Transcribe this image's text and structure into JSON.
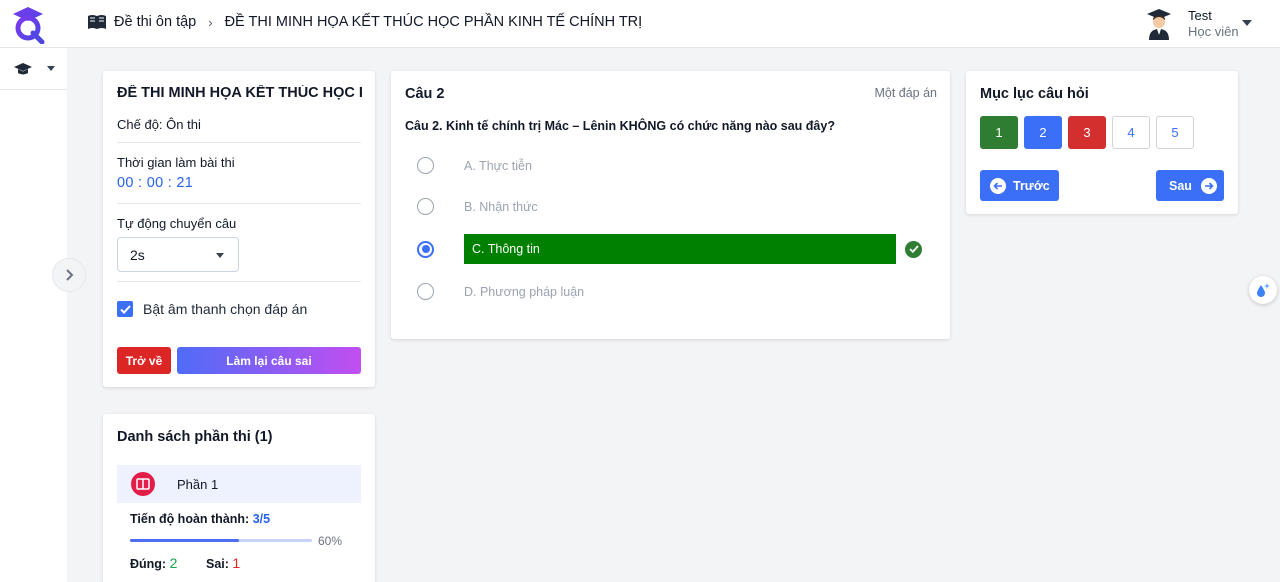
{
  "header": {
    "breadcrumb_root": "Đề thi ôn tập",
    "breadcrumb_current": "ĐỀ THI MINH HỌA KẾT THÚC HỌC PHẦN KINH TẾ CHÍNH TRỊ",
    "user_name": "Test",
    "user_role": "Học viên"
  },
  "info": {
    "title": "ĐỀ THI MINH HỌA KẾT THÚC HỌC PHẦN KINH TẾ CHÍNH TRỊ",
    "mode": "Chế độ: Ôn thi",
    "time_label": "Thời gian làm bài thi",
    "timer": "00 : 00 : 21",
    "auto_label": "Tự động chuyển câu",
    "auto_value": "2s",
    "sound_label": "Bật âm thanh chọn đáp án",
    "sound_checked": true,
    "back_label": "Trở về",
    "redo_label": "Làm lại câu sai"
  },
  "parts": {
    "title": "Danh sách phần thi (1)",
    "items": [
      {
        "name": "Phần 1",
        "progress_label": "Tiến độ hoàn thành:",
        "progress_value": "3/5",
        "progress_percent": 60,
        "percent_label": "60%",
        "correct_label": "Đúng:",
        "correct_value": "2",
        "wrong_label": "Sai:",
        "wrong_value": "1"
      }
    ]
  },
  "question": {
    "number_label": "Câu 2",
    "type_label": "Một đáp án",
    "text": "Câu 2. Kinh tế chính trị Mác – Lênin KHÔNG có chức năng nào sau đây?",
    "options": [
      {
        "label": "A. Thực tiễn",
        "selected": false
      },
      {
        "label": "B. Nhận thức",
        "selected": false
      },
      {
        "label": "C. Thông tin",
        "selected": true,
        "correct": true
      },
      {
        "label": "D. Phương pháp luận",
        "selected": false
      }
    ]
  },
  "index": {
    "title": "Mục lục câu hỏi",
    "items": [
      {
        "label": "1",
        "status": "correct"
      },
      {
        "label": "2",
        "status": "current"
      },
      {
        "label": "3",
        "status": "wrong"
      },
      {
        "label": "4",
        "status": "unanswered"
      },
      {
        "label": "5",
        "status": "unanswered"
      }
    ],
    "prev_label": "Trước",
    "next_label": "Sau"
  },
  "colors": {
    "correct": "#2e7d32",
    "current": "#3b6ff5",
    "wrong": "#d32f2f",
    "answer_highlight": "#008000"
  }
}
